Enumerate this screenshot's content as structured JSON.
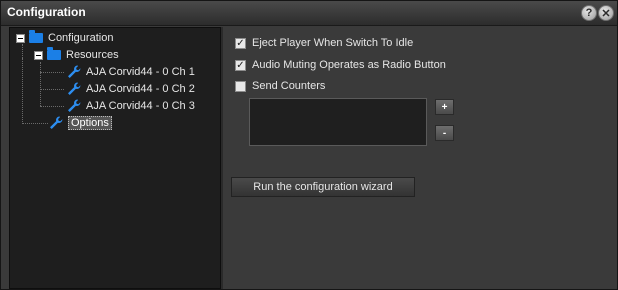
{
  "window": {
    "title": "Configuration"
  },
  "titlebar_buttons": {
    "help": "?",
    "close": "✕"
  },
  "tree": {
    "root": "Configuration",
    "resources": "Resources",
    "items": [
      "AJA Corvid44 - 0 Ch 1",
      "AJA Corvid44 - 0 Ch 2",
      "AJA Corvid44 - 0 Ch 3"
    ],
    "options": "Options"
  },
  "options": {
    "eject": {
      "label": "Eject Player When Switch To Idle",
      "checked": true
    },
    "audio_muting": {
      "label": "Audio Muting Operates as Radio Button",
      "checked": true
    },
    "send_counters": {
      "label": "Send Counters",
      "checked": false
    },
    "add_label": "+",
    "remove_label": "-",
    "wizard_label": "Run the configuration wizard"
  },
  "colors": {
    "folder": "#1b7fe6",
    "wrench": "#2d8ef0"
  }
}
